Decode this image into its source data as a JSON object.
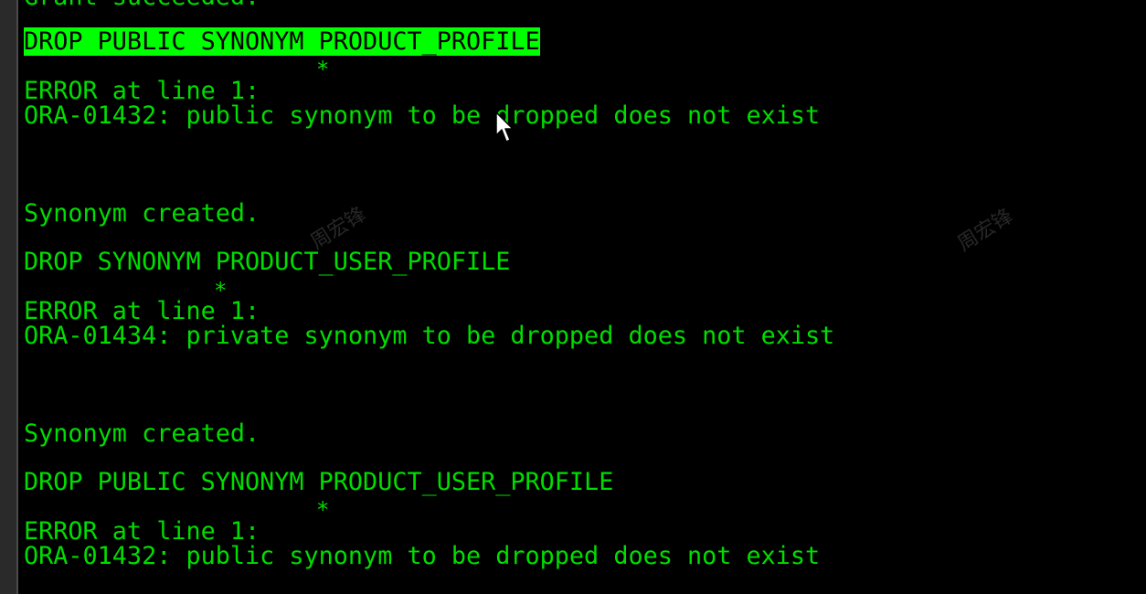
{
  "terminal": {
    "lines": [
      "Grant succeeded.",
      "DROP PUBLIC SYNONYM PRODUCT_PROFILE",
      "*",
      "ERROR at line 1:",
      "ORA-01432: public synonym to be dropped does not exist",
      "Synonym created.",
      "DROP SYNONYM PRODUCT_USER_PROFILE",
      "*",
      "ERROR at line 1:",
      "ORA-01434: private synonym to be dropped does not exist",
      "Synonym created.",
      "DROP PUBLIC SYNONYM PRODUCT_USER_PROFILE",
      "*",
      "ERROR at line 1:",
      "ORA-01432: public synonym to be dropped does not exist"
    ]
  },
  "watermarks": [
    "周宏锋",
    "周宏锋"
  ],
  "colors": {
    "background": "#000000",
    "text": "#00dd00",
    "highlight_bg": "#00ff00",
    "highlight_text": "#000000"
  },
  "icons": {
    "cursor": "mouse-pointer-icon"
  }
}
